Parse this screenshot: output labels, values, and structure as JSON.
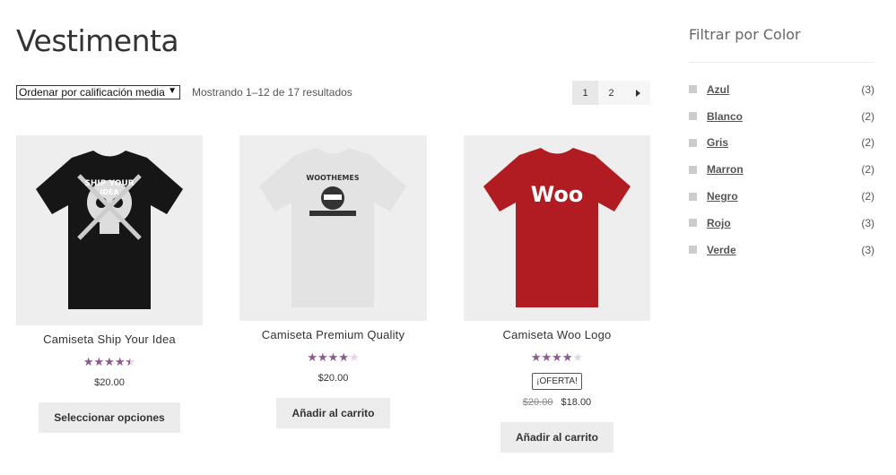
{
  "page": {
    "title": "Vestimenta"
  },
  "toolbar": {
    "sort_selected": "Ordenar por calificación media",
    "result_count": "Mostrando 1–12 de 17 resultados",
    "pages": [
      "1",
      "2"
    ],
    "current_page": "1"
  },
  "products": [
    {
      "name": "Camiseta Ship Your Idea",
      "rating": 4.5,
      "price": "$20.00",
      "button": "Seleccionar opciones",
      "shirt_color": "#161616",
      "graphic": "skull"
    },
    {
      "name": "Camiseta Premium Quality",
      "rating": 4,
      "price": "$20.00",
      "button": "Añadir al carrito",
      "shirt_color": "#e3e3e3",
      "graphic": "ninja"
    },
    {
      "name": "Camiseta Woo Logo",
      "rating": 4,
      "badge": "¡OFERTA!",
      "old_price": "$20.00",
      "price": "$18.00",
      "button": "Añadir al carrito",
      "shirt_color": "#b01c22",
      "graphic": "woo"
    }
  ],
  "sidebar": {
    "widget_title": "Filtrar por Color",
    "filters": [
      {
        "label": "Azul",
        "count": "(3)"
      },
      {
        "label": "Blanco",
        "count": "(2)"
      },
      {
        "label": "Gris",
        "count": "(2)"
      },
      {
        "label": "Marron",
        "count": "(2)"
      },
      {
        "label": "Negro",
        "count": "(2)"
      },
      {
        "label": "Rojo",
        "count": "(3)"
      },
      {
        "label": "Verde",
        "count": "(3)"
      }
    ]
  },
  "graphics": {
    "shirt1_text_a": "SHIP YOUR",
    "shirt1_text_b": "IDEA",
    "shirt2_text": "WOOTHEMES",
    "shirt3_text": "Woo"
  },
  "colors": {
    "accent_star": "#8c5a8e",
    "button_bg": "#ececec"
  }
}
